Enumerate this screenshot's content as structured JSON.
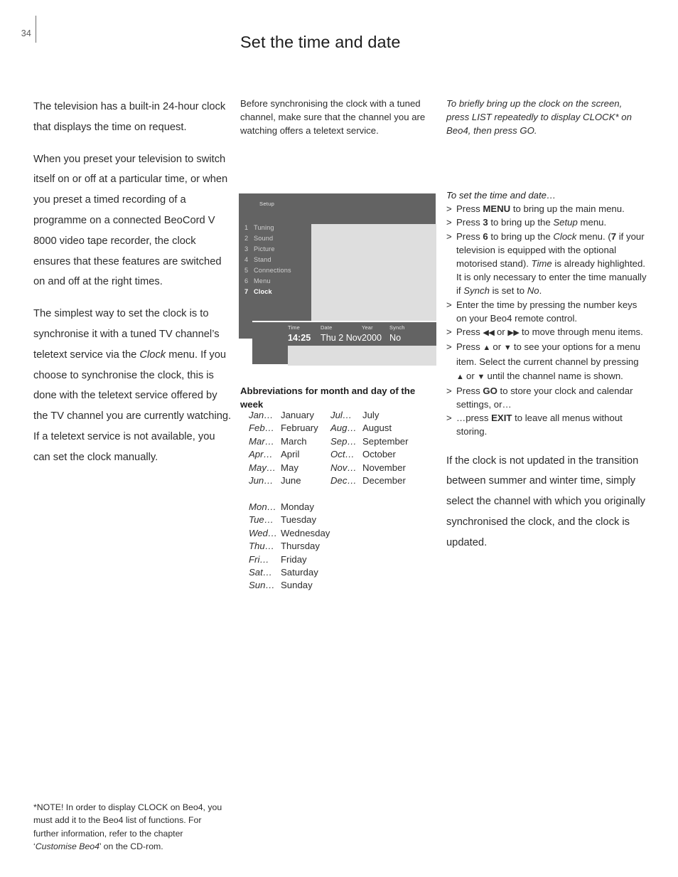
{
  "page": {
    "number": "34",
    "title": "Set the time and date"
  },
  "left_column": {
    "paragraphs": [
      "The television has a built-in 24-hour clock that displays the time on request.",
      "When you preset your television to switch itself on or off at a particular time, or when you preset a timed recording of a programme on a connected BeoCord V 8000 video tape recorder, the clock ensures that these features are switched on and off at the right times."
    ],
    "paragraph3": {
      "part1": "The simplest way to set the clock is to synchronise it with a tuned TV channel’s teletext service via the ",
      "italic1": "Clock",
      "part2": " menu. If you choose to synchronise the clock, this is done with the teletext service offered by the TV channel you are currently watching. If a teletext service is not available, you can set the clock manually."
    }
  },
  "middle_column": {
    "intro": "Before synchronising the clock with a tuned channel, make sure that the channel you are watching offers a teletext service.",
    "abbrev_heading": "Abbreviations for month and day of the week",
    "months": [
      {
        "ab": "Jan…",
        "full": "January",
        "ab2": "Jul…",
        "full2": "July"
      },
      {
        "ab": "Feb…",
        "full": "February",
        "ab2": "Aug…",
        "full2": "August"
      },
      {
        "ab": "Mar…",
        "full": "March",
        "ab2": "Sep…",
        "full2": "September"
      },
      {
        "ab": "Apr…",
        "full": "April",
        "ab2": "Oct…",
        "full2": "October"
      },
      {
        "ab": "May…",
        "full": "May",
        "ab2": "Nov…",
        "full2": "November"
      },
      {
        "ab": "Jun…",
        "full": "June",
        "ab2": "Dec…",
        "full2": "December"
      }
    ],
    "days": [
      {
        "ab": "Mon…",
        "full": "Monday"
      },
      {
        "ab": "Tue…",
        "full": "Tuesday"
      },
      {
        "ab": "Wed…",
        "full": "Wednesday"
      },
      {
        "ab": "Thu…",
        "full": "Thursday"
      },
      {
        "ab": "Fri…",
        "full": "Friday"
      },
      {
        "ab": "Sat…",
        "full": "Saturday"
      },
      {
        "ab": "Sun…",
        "full": "Sunday"
      }
    ]
  },
  "tv_graphic": {
    "setup_label": "Setup",
    "menu_items": [
      {
        "num": "1",
        "label": "Tuning",
        "selected": false
      },
      {
        "num": "2",
        "label": "Sound",
        "selected": false
      },
      {
        "num": "3",
        "label": "Picture",
        "selected": false
      },
      {
        "num": "4",
        "label": "Stand",
        "selected": false
      },
      {
        "num": "5",
        "label": "Connections",
        "selected": false
      },
      {
        "num": "6",
        "label": "Menu",
        "selected": false
      },
      {
        "num": "7",
        "label": "Clock",
        "selected": true
      }
    ],
    "clock_panel": {
      "headers": {
        "time": "Time",
        "date": "Date",
        "year": "Year",
        "synch": "Synch"
      },
      "values": {
        "time": "14:25",
        "date": "Thu 2 Nov",
        "year": "2000",
        "synch": "No"
      }
    },
    "colors": {
      "panel_dark": "#636363",
      "panel_light": "#dedede",
      "text_light": "#cfcfcf",
      "text_selected": "#ffffff"
    }
  },
  "right_column": {
    "intro_italic": "To briefly bring up the clock on the screen, press LIST repeatedly to display CLOCK* on Beo4, then press GO.",
    "steps_heading": "To set the time and date…",
    "steps": [
      {
        "marker": ">",
        "html": "Press <strong>MENU</strong> to bring up the main menu."
      },
      {
        "marker": ">",
        "html": "Press <strong>3</strong> to bring up the <em>Setup</em> menu."
      },
      {
        "marker": ">",
        "html": "Press <strong>6</strong> to bring up the <em>Clock</em> menu. (<strong>7</strong> if your television is equipped with the optional motorised stand). <em>Time</em> is already highlighted. It is only necessary to enter the time manually if <em>Synch</em> is set to <em>No</em>."
      },
      {
        "marker": ">",
        "html": "Enter the time by pressing the number keys on your Beo4 remote control."
      },
      {
        "marker": ">",
        "html": "Press <span class=\"glyph\">◀◀</span> or <span class=\"glyph\">▶▶</span> to move through menu items."
      },
      {
        "marker": ">",
        "html": "Press <span class=\"glyph\">▲</span> or <span class=\"glyph\">▼</span> to see your options for a menu item. Select the current channel by pressing <span class=\"glyph\">▲</span> or <span class=\"glyph\">▼</span> until the channel name is shown."
      },
      {
        "marker": ">",
        "html": "Press <strong>GO</strong> to store your clock and calendar settings, or…"
      },
      {
        "marker": ">",
        "html": "…press <strong>EXIT</strong> to leave all menus without storing."
      }
    ],
    "closing_italic": "If the clock is not updated in the transition between summer and winter time, simply select the channel with which you originally synchronised the clock, and the clock is updated."
  },
  "footnote": {
    "part1": "*NOTE! In order to display CLOCK on Beo4, you must add it to the Beo4 list of functions. For further information, refer to the chapter ‘",
    "italic": "Customise Beo4",
    "part2": "’ on the CD-rom."
  }
}
